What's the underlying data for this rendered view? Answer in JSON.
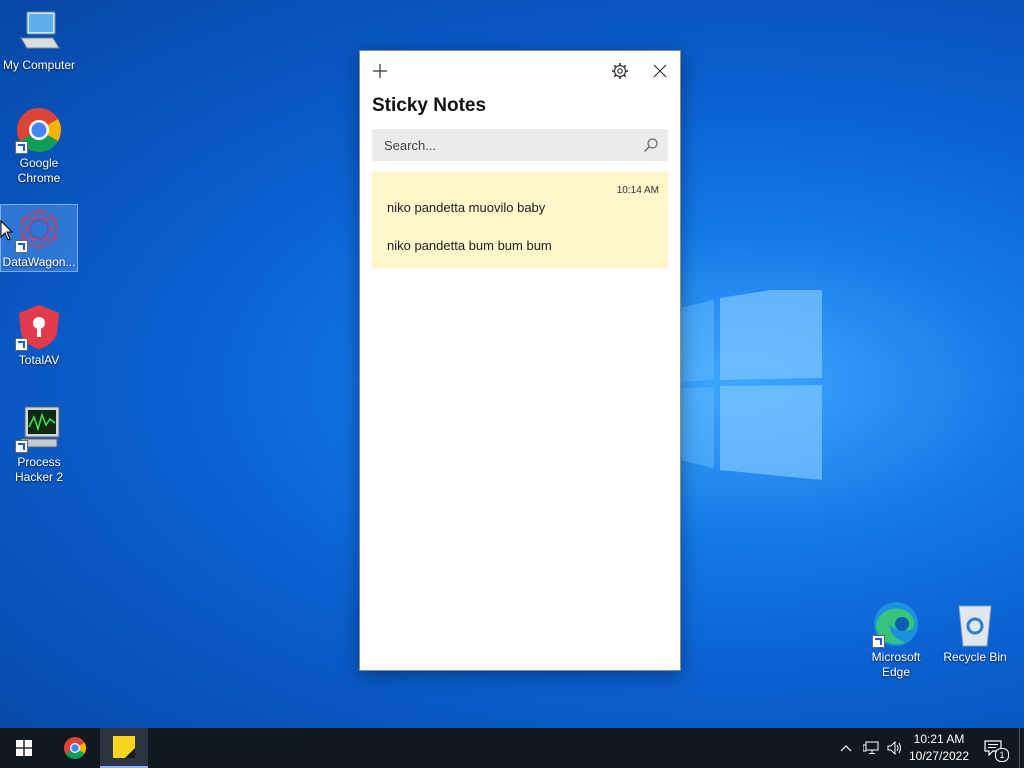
{
  "desktop": {
    "icons": [
      {
        "label": "My Computer"
      },
      {
        "label": "Google Chrome"
      },
      {
        "label": "DataWagon..."
      },
      {
        "label": "TotalAV"
      },
      {
        "label": "Process Hacker 2"
      },
      {
        "label": "Microsoft Edge"
      },
      {
        "label": "Recycle Bin"
      }
    ]
  },
  "sticky_notes": {
    "title": "Sticky Notes",
    "search_placeholder": "Search...",
    "notes": [
      {
        "time": "10:14 AM",
        "line1": "niko pandetta muovilo baby",
        "line2": "niko pandetta bum bum bum",
        "color": "#fff6cc"
      }
    ]
  },
  "taskbar": {
    "time": "10:21 AM",
    "date": "10/27/2022",
    "notification_count": "1",
    "apps": [
      "start-icon",
      "chrome-icon",
      "sticky-notes-icon"
    ]
  }
}
